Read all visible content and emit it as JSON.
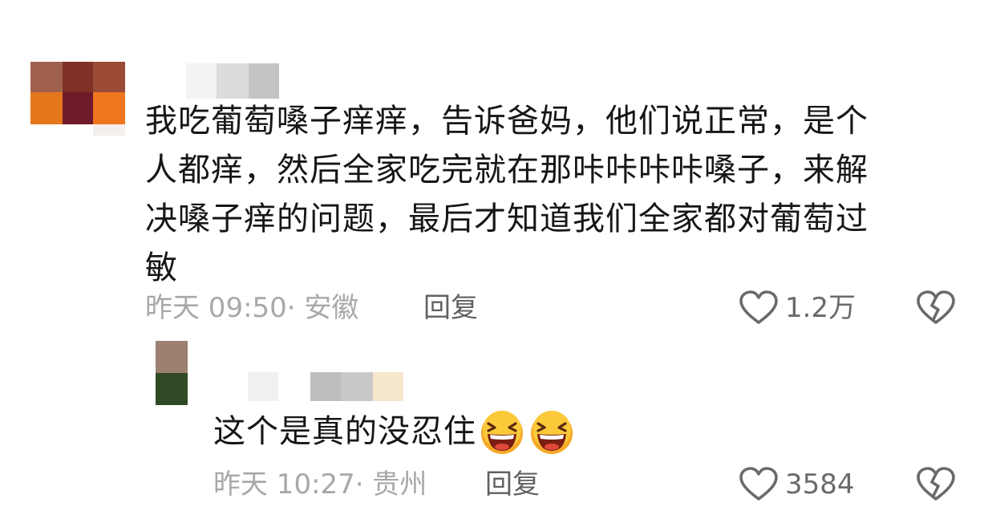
{
  "comments": [
    {
      "text_lines": [
        "我吃葡萄嗓子痒痒，告诉爸妈，他们说正常，是个",
        "人都痒，然后全家吃完就在那咔咔咔咔嗓子，来解",
        "决嗓子痒的问题，最后才知道我们全家都对葡萄过",
        "敏"
      ],
      "time_location": "昨天 09:50· 安徽",
      "reply_label": "回复",
      "like_count": "1.2万",
      "avatar_colors": [
        "#a0604e",
        "#7f3127",
        "#9a4a35",
        "#e4771c",
        "#6e1a2a",
        "#f0761e"
      ],
      "username_colors": [
        "#f3f3f3",
        "#dcdcdc",
        "#c4c4c4"
      ]
    }
  ],
  "replies": [
    {
      "text": "这个是真的没忍住",
      "emoji": [
        "laughing-emoji",
        "laughing-emoji"
      ],
      "time_location": "昨天 10:27· 贵州",
      "reply_label": "回复",
      "like_count": "3584",
      "avatar_colors": [
        "#9c8070",
        "#2f4a24"
      ],
      "username_colors": [
        "#f0f0f0",
        "#bdbdbd",
        "#c9c9c9",
        "#f6e8cc"
      ]
    }
  ],
  "icons": {
    "like": "heart-outline-icon",
    "dislike": "broken-heart-icon"
  },
  "colors": {
    "text": "#161616",
    "meta": "#a8a8a8",
    "reply": "#616161",
    "icon": "#6a6a6a"
  }
}
